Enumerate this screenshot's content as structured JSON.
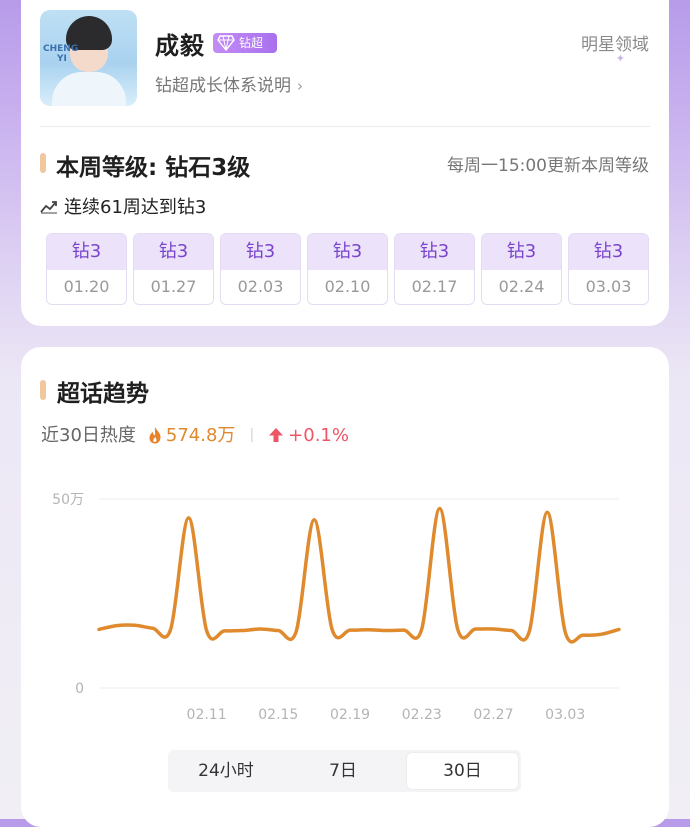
{
  "profile": {
    "name": "成毅",
    "badge_label": "钻超",
    "growth_link": "钻超成长体系说明",
    "domain_label": "明星领域",
    "avatar_watermark": [
      "CHENG",
      "YI"
    ]
  },
  "level": {
    "title": "本周等级: 钻石3级",
    "update_note": "每周一15:00更新本周等级",
    "streak": "连续61周达到钻3",
    "weeks": [
      {
        "level": "钻3",
        "date": "01.20"
      },
      {
        "level": "钻3",
        "date": "01.27"
      },
      {
        "level": "钻3",
        "date": "02.03"
      },
      {
        "level": "钻3",
        "date": "02.10"
      },
      {
        "level": "钻3",
        "date": "02.17"
      },
      {
        "level": "钻3",
        "date": "02.24"
      },
      {
        "level": "钻3",
        "date": "03.03"
      }
    ]
  },
  "trend": {
    "title": "超话趋势",
    "heat_label": "近30日热度",
    "heat_value": "574.8万",
    "change": "+0.1%",
    "ranges": [
      "24小时",
      "7日",
      "30日"
    ],
    "active_range": "30日"
  },
  "colors": {
    "accent": "#e08a2e",
    "purple": "#7a45cc",
    "up": "#ee5566"
  },
  "icons": {
    "flame": "flame-icon",
    "up_arrow": "up-arrow-icon",
    "trend": "trend-line-icon",
    "diamond": "diamond-icon",
    "chevron": "chevron-right-icon"
  },
  "chart_data": {
    "type": "line",
    "title": "",
    "xlabel": "",
    "ylabel": "",
    "y_tick_labels": [
      "0",
      "50万"
    ],
    "ylim": [
      0,
      50
    ],
    "y_unit": "万",
    "x_tick_labels": [
      "02.11",
      "02.15",
      "02.19",
      "02.23",
      "02.27",
      "03.03"
    ],
    "grid": "horizontal",
    "series": [
      {
        "x": [
          "02.05",
          "02.06",
          "02.07",
          "02.08",
          "02.09",
          "02.10",
          "02.11",
          "02.12",
          "02.13",
          "02.14",
          "02.15",
          "02.16",
          "02.17",
          "02.18",
          "02.19",
          "02.20",
          "02.21",
          "02.22",
          "02.23",
          "02.24",
          "02.25",
          "02.26",
          "02.27",
          "02.28",
          "03.01",
          "03.02",
          "03.03",
          "03.04",
          "03.05",
          "03.06"
        ],
        "values": [
          15.5,
          16.5,
          16.6,
          15.8,
          15.6,
          45,
          15.2,
          15.1,
          15.2,
          15.6,
          15.2,
          15.0,
          44.5,
          15.5,
          15.3,
          15.4,
          15.2,
          15.3,
          15.6,
          47.5,
          15.6,
          15.6,
          15.6,
          15.2,
          15.0,
          46.5,
          14.8,
          14.0,
          14.2,
          15.5
        ]
      }
    ]
  }
}
